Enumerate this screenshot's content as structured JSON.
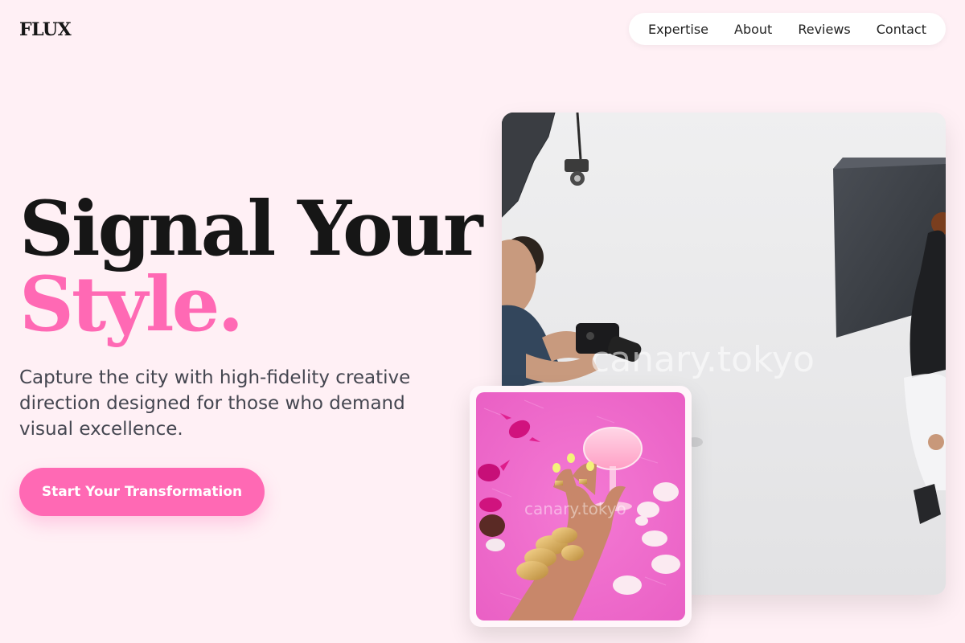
{
  "brand": {
    "logo_text": "FLUX"
  },
  "nav": {
    "items": [
      {
        "label": "Expertise"
      },
      {
        "label": "About"
      },
      {
        "label": "Reviews"
      },
      {
        "label": "Contact"
      }
    ]
  },
  "hero": {
    "headline_line1": "Signal Your",
    "headline_line2": "Style.",
    "subtitle": "Capture the city with high-fidelity creative direction designed for those who demand visual excellence.",
    "cta_label": "Start Your Transformation"
  },
  "images": {
    "main": {
      "watermark": "canary.tokyo"
    },
    "card": {
      "watermark": "canary.tokyo"
    }
  },
  "colors": {
    "background": "#fff0f5",
    "accent": "#ff69b4",
    "text_dark": "#161616",
    "text_muted": "#444650"
  }
}
